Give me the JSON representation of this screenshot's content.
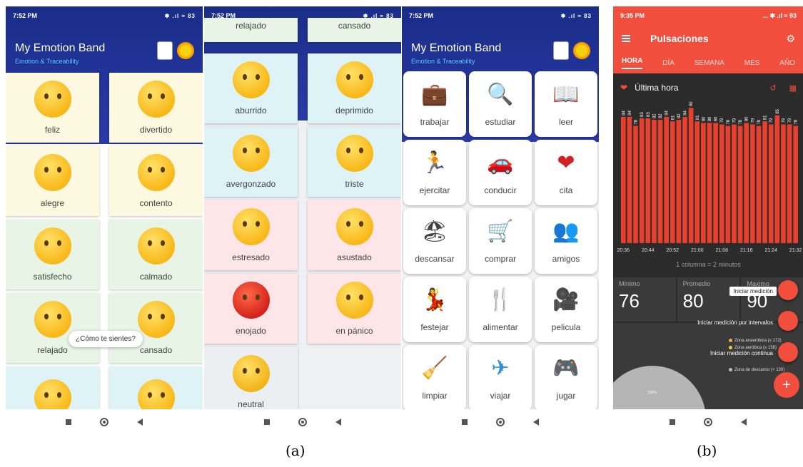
{
  "panels": {
    "p1": {
      "time": "7:52 PM",
      "status_icons": "✱ .ıl ≈ 83",
      "app_title": "My Emotion Band",
      "app_subtitle": "Emotion & Traceability",
      "tiles": [
        {
          "label": "feliz"
        },
        {
          "label": "divertido"
        },
        {
          "label": "alegre"
        },
        {
          "label": "contento"
        },
        {
          "label": "satisfecho"
        },
        {
          "label": "calmado"
        },
        {
          "label": "relajado"
        },
        {
          "label": "cansado"
        }
      ],
      "toast": "¿Cómo te sientes?"
    },
    "p2": {
      "time": "7:52 PM",
      "status_icons": "✱ .ıl ≈ 83",
      "tiles": [
        {
          "label": "relajado"
        },
        {
          "label": "cansado"
        },
        {
          "label": "aburrido"
        },
        {
          "label": "deprimido"
        },
        {
          "label": "avergonzado"
        },
        {
          "label": "triste"
        },
        {
          "label": "estresado"
        },
        {
          "label": "asustado"
        },
        {
          "label": "enojado"
        },
        {
          "label": "en pánico"
        },
        {
          "label": "neutral"
        }
      ]
    },
    "p3": {
      "time": "7:52 PM",
      "status_icons": "✱ .ıl ≈ 83",
      "app_title": "My Emotion Band",
      "app_subtitle": "Emotion & Traceability",
      "activities": [
        {
          "label": "trabajar",
          "icon": "💼"
        },
        {
          "label": "estudiar",
          "icon": "🔍"
        },
        {
          "label": "leer",
          "icon": "📖"
        },
        {
          "label": "ejercitar",
          "icon": "🏃"
        },
        {
          "label": "conducir",
          "icon": "🚗"
        },
        {
          "label": "cita",
          "icon": "❤"
        },
        {
          "label": "descansar",
          "icon": "🏖"
        },
        {
          "label": "comprar",
          "icon": "🛒"
        },
        {
          "label": "amigos",
          "icon": "👥"
        },
        {
          "label": "festejar",
          "icon": "💃"
        },
        {
          "label": "alimentar",
          "icon": "🍴"
        },
        {
          "label": "pelicula",
          "icon": "🎥"
        },
        {
          "label": "limpiar",
          "icon": "🧹"
        },
        {
          "label": "viajar",
          "icon": "✈"
        },
        {
          "label": "jugar",
          "icon": "🎮"
        }
      ]
    },
    "p4": {
      "time": "9:35 PM",
      "status_icons": "... ✱ .ıl ≈ 93",
      "title": "Pulsaciones",
      "tabs": [
        "HORA",
        "DÍA",
        "SEMANA",
        "MES",
        "AÑO"
      ],
      "active_tab": "HORA",
      "section_title": "Última hora",
      "chart_note": "1 columna = 2 minutos",
      "stats": [
        {
          "label": "Mínimo",
          "value": "76"
        },
        {
          "label": "Promedio",
          "value": "80"
        },
        {
          "label": "Maximo",
          "value": "90"
        }
      ],
      "fab_labels": [
        "Iniciar medición",
        "Iniciar medición por intervalos",
        "Iniciar medición continua"
      ],
      "fab_main": "+",
      "legend": [
        {
          "label": "Zona anaeróbica (≥ 172)",
          "color": "#f0b23c"
        },
        {
          "label": "Zona aeróbica (≥ 158)",
          "color": "#f0c93c"
        },
        {
          "label": "Zona de descanso (< 130)",
          "color": "#bbbbbb"
        }
      ],
      "pie_label": "100%"
    }
  },
  "chart_data": {
    "type": "bar",
    "title": "Última hora",
    "categories": [
      "20:36",
      "20:38",
      "20:40",
      "20:42",
      "20:44",
      "20:46",
      "20:48",
      "20:50",
      "20:52",
      "20:54",
      "20:56",
      "20:58",
      "21:00",
      "21:02",
      "21:04",
      "21:06",
      "21:08",
      "21:10",
      "21:12",
      "21:14",
      "21:16",
      "21:18",
      "21:20",
      "21:22",
      "21:24",
      "21:26",
      "21:28",
      "21:30",
      "21:32"
    ],
    "values": [
      84,
      84,
      78,
      83,
      83,
      82,
      82,
      84,
      81,
      82,
      84,
      90,
      81,
      80,
      80,
      80,
      79,
      78,
      79,
      78,
      80,
      79,
      78,
      81,
      79,
      85,
      79,
      79,
      78
    ],
    "x_tick_labels": [
      "20:36",
      "20:44",
      "20:52",
      "21:00",
      "21:08",
      "21:16",
      "21:24",
      "21:32"
    ],
    "bar_color": "#e8402f",
    "xlabel": "",
    "ylabel": ""
  },
  "captions": {
    "a": "(a)",
    "b": "(b)"
  }
}
